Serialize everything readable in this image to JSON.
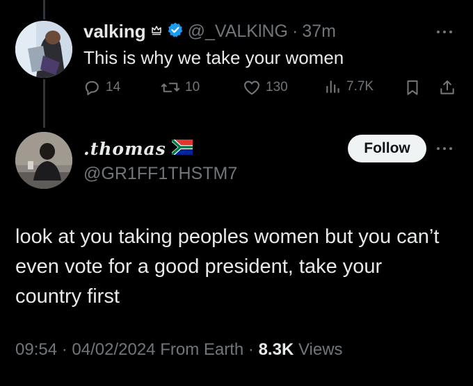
{
  "reply_tweet": {
    "author_name": "valking",
    "author_handle": "@_VALKlNG",
    "separator": "·",
    "time": "37m",
    "text": "This is why we take your women",
    "replies": "14",
    "reposts": "10",
    "likes": "130",
    "views": "7.7K",
    "verified_icon": "verified-badge-icon",
    "crown_icon": "crown-icon"
  },
  "main_tweet": {
    "author_name": ".thomas",
    "flag_icon": "south-africa-flag-icon",
    "author_handle": "@GR1FF1THSTM7",
    "follow_label": "Follow",
    "text": "look at you taking peoples women but you can’t even vote for a good president, take your country first",
    "time": "09:54",
    "date": "04/02/2024",
    "source": "From Earth",
    "separator": "·",
    "views_count": "8.3K",
    "views_label": "Views"
  },
  "colors": {
    "background": "#000000",
    "text_primary": "#e7e9ea",
    "text_secondary": "#71767b",
    "verified_blue": "#1d9bf0",
    "follow_bg": "#eff3f4"
  }
}
